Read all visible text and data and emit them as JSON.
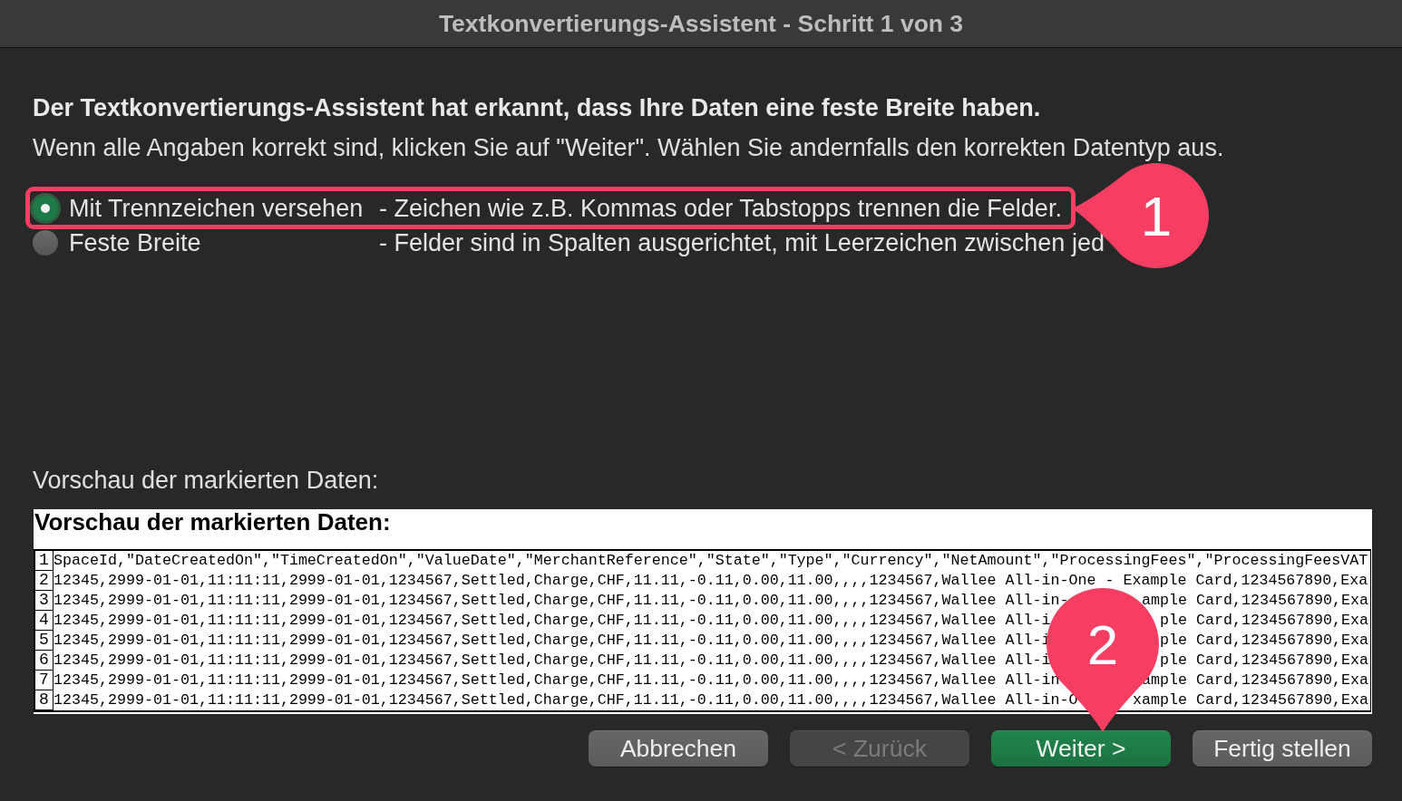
{
  "window": {
    "title": "Textkonvertierungs-Assistent - Schritt 1 von 3"
  },
  "heading": "Der Textkonvertierungs-Assistent hat erkannt, dass Ihre Daten eine feste Breite haben.",
  "instruction": "Wenn alle Angaben korrekt sind, klicken Sie auf \"Weiter\". Wählen Sie andernfalls den korrekten Datentyp aus.",
  "data_type_options": [
    {
      "label": "Mit Trennzeichen versehen",
      "description": "- Zeichen wie z.B. Kommas oder Tabstopps trennen die Felder.",
      "selected": true,
      "highlighted": true,
      "callout": "1"
    },
    {
      "label": "Feste Breite",
      "description": "- Felder sind in Spalten ausgerichtet, mit Leerzeichen zwischen jed",
      "selected": false,
      "highlighted": false
    }
  ],
  "preview": {
    "label": "Vorschau der markierten Daten:",
    "title": "Vorschau der markierten Daten:",
    "rows": [
      {
        "number": "1",
        "segments": [
          "SpaceId,\"DateCreatedOn\",\"TimeCreatedOn\",\"ValueDate\",\"MerchantReference\",\"State\",\"Type\",\"Currency\",\"NetAmount\",\"ProcessingFees\",\"ProcessingFeesVAT"
        ]
      },
      {
        "number": "2",
        "segments": [
          "12345,2999-01-01,11:11:11,2999-01-01,1234567,Settled,Charge,CHF,11.11,-0.11,0.00,11.00,,,,1234567,Wallee All-in-One - Example Card,1234567890,Exa"
        ]
      },
      {
        "number": "3",
        "segments": [
          "12345,2999-01-01,11:11:11,2999-01-01,1234567,Settled,Charge,CHF,11.11,-0.11,0.00,11.00,,,,1234567,Wallee All-in-",
          "ample Card,1234567890,Exa"
        ]
      },
      {
        "number": "4",
        "segments": [
          "12345,2999-01-01,11:11:11,2999-01-01,1234567,Settled,Charge,CHF,11.11,-0.11,0.00,11.00,,,,1234567,Wallee All-i",
          "ple Card,1234567890,Exa"
        ]
      },
      {
        "number": "5",
        "segments": [
          "12345,2999-01-01,11:11:11,2999-01-01,1234567,Settled,Charge,CHF,11.11,-0.11,0.00,11.00,,,,1234567,Wallee All-i",
          "ple Card,1234567890,Exa"
        ]
      },
      {
        "number": "6",
        "segments": [
          "12345,2999-01-01,11:11:11,2999-01-01,1234567,Settled,Charge,CHF,11.11,-0.11,0.00,11.00,,,,1234567,Wallee All-i",
          "ple Card,1234567890,Exa"
        ]
      },
      {
        "number": "7",
        "segments": [
          "12345,2999-01-01,11:11:11,2999-01-01,1234567,Settled,Charge,CHF,11.11,-0.11,0.00,11.00,,,,1234567,Wallee All-in",
          "ample Card,1234567890,Exa"
        ]
      },
      {
        "number": "8",
        "segments": [
          "12345,2999-01-01,11:11:11,2999-01-01,1234567,Settled,Charge,CHF,11.11,-0.11,0.00,11.00,,,,1234567,Wallee All-in-O",
          "xample Card,1234567890,Exa"
        ]
      }
    ]
  },
  "buttons": [
    {
      "label": "Abbrechen",
      "kind": "normal",
      "disabled": false
    },
    {
      "label": "< Zurück",
      "kind": "normal",
      "disabled": true
    },
    {
      "label": "Weiter >",
      "kind": "default",
      "disabled": false,
      "callout": "2"
    },
    {
      "label": "Fertig stellen",
      "kind": "normal",
      "disabled": false
    }
  ]
}
